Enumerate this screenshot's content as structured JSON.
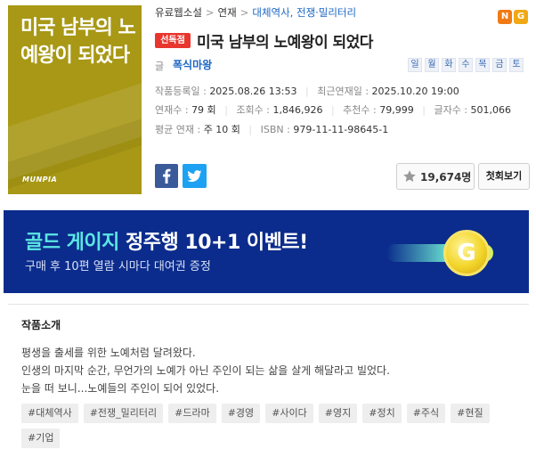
{
  "cover": {
    "title": "미국 남부의 노예왕이 되었다",
    "logo": "MUNPIA",
    "bg_color": "#a89815"
  },
  "breadcrumb": [
    "유료웹소설",
    "연재",
    "대체역사, 전쟁·밀리터리"
  ],
  "badges": [
    "N",
    "G"
  ],
  "novel": {
    "exclusive_label": "선독점",
    "title": "미국 남부의 노예왕이 되었다",
    "author_label": "글",
    "author": "폭식마왕"
  },
  "days": [
    "일",
    "월",
    "화",
    "수",
    "목",
    "금",
    "토"
  ],
  "meta": {
    "registered_label": "작품등록일 :",
    "registered": "2025.08.26 13:53",
    "latest_label": "최근연재일 :",
    "latest": "2025.10.20 19:00",
    "episodes_label": "연재수 :",
    "episodes": "79 회",
    "views_label": "조회수 :",
    "views": "1,846,926",
    "recs_label": "추천수 :",
    "recs": "79,999",
    "chars_label": "글자수 :",
    "chars": "501,066",
    "avg_label": "평균 연재 :",
    "avg": "주 10 회",
    "isbn_label": "ISBN :",
    "isbn": "979-11-11-98645-1"
  },
  "actions": {
    "recommend_count": "19,674명",
    "first_view": "첫회보기"
  },
  "banner": {
    "highlight": "골드 게이지",
    "rest": " 정주행 10+1 이벤트!",
    "sub": "구매 후 10편 열람 시마다 대여권 증정",
    "coin": "G"
  },
  "intro": {
    "title": "작품소개",
    "lines": [
      "평생을 출세를 위한 노예처럼 달려왔다.",
      "인생의 마지막 순간, 무언가의 노예가 아닌 주인이 되는 삶을 살게 해달라고 빌었다.",
      "눈을 떠 보니...노예들의 주인이 되어 있었다."
    ]
  },
  "tags": [
    "#대체역사",
    "#전쟁_밀리터리",
    "#드라마",
    "#경영",
    "#사이다",
    "#영지",
    "#정치",
    "#주식",
    "#현질",
    "#기업"
  ],
  "colors": {
    "link": "#1a66c5",
    "exclusive": "#e8362f",
    "banner_bg": "#0b2c8c",
    "banner_highlight": "#5be7e4"
  }
}
